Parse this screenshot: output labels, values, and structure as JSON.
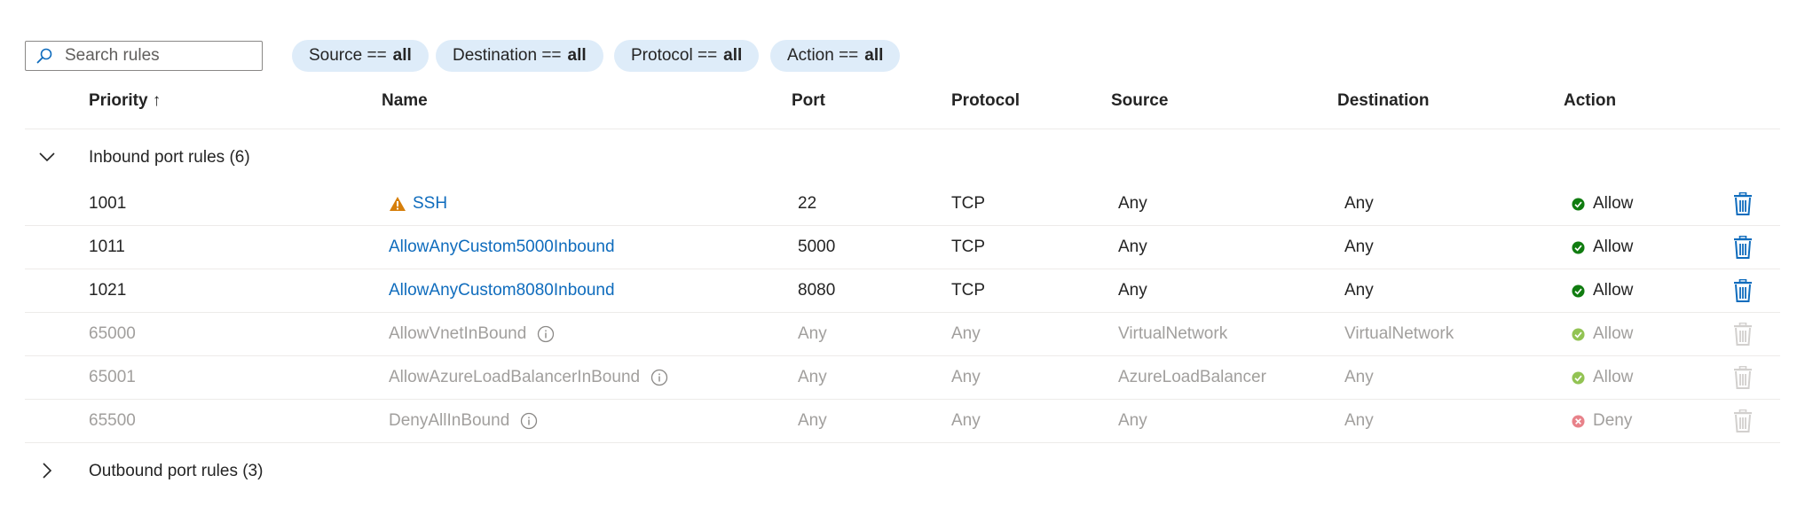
{
  "search": {
    "placeholder": "Search rules"
  },
  "filters": [
    {
      "label": "Source ==",
      "value": "all"
    },
    {
      "label": "Destination ==",
      "value": "all"
    },
    {
      "label": "Protocol ==",
      "value": "all"
    },
    {
      "label": "Action ==",
      "value": "all"
    }
  ],
  "columns": {
    "priority": "Priority ↑",
    "name": "Name",
    "port": "Port",
    "protocol": "Protocol",
    "source": "Source",
    "destination": "Destination",
    "action": "Action"
  },
  "inbound": {
    "label": "Inbound port rules (6)",
    "rules": [
      {
        "priority": "1001",
        "name": "SSH",
        "port": "22",
        "protocol": "TCP",
        "source": "Any",
        "destination": "Any",
        "action": "Allow"
      },
      {
        "priority": "1011",
        "name": "AllowAnyCustom5000Inbound",
        "port": "5000",
        "protocol": "TCP",
        "source": "Any",
        "destination": "Any",
        "action": "Allow"
      },
      {
        "priority": "1021",
        "name": "AllowAnyCustom8080Inbound",
        "port": "8080",
        "protocol": "TCP",
        "source": "Any",
        "destination": "Any",
        "action": "Allow"
      },
      {
        "priority": "65000",
        "name": "AllowVnetInBound",
        "port": "Any",
        "protocol": "Any",
        "source": "VirtualNetwork",
        "destination": "VirtualNetwork",
        "action": "Allow"
      },
      {
        "priority": "65001",
        "name": "AllowAzureLoadBalancerInBound",
        "port": "Any",
        "protocol": "Any",
        "source": "AzureLoadBalancer",
        "destination": "Any",
        "action": "Allow"
      },
      {
        "priority": "65500",
        "name": "DenyAllInBound",
        "port": "Any",
        "protocol": "Any",
        "source": "Any",
        "destination": "Any",
        "action": "Deny"
      }
    ]
  },
  "outbound": {
    "label": "Outbound port rules (3)"
  },
  "colors": {
    "link": "#0f6cbd",
    "muted_text": "#a19f9d",
    "allow_green": "#107c10",
    "allow_green_muted": "#92c353",
    "deny_red": "#d13438",
    "deny_red_muted": "#e8828a",
    "warning_orange": "#d67f0b",
    "pill_bg": "#deecf9"
  }
}
